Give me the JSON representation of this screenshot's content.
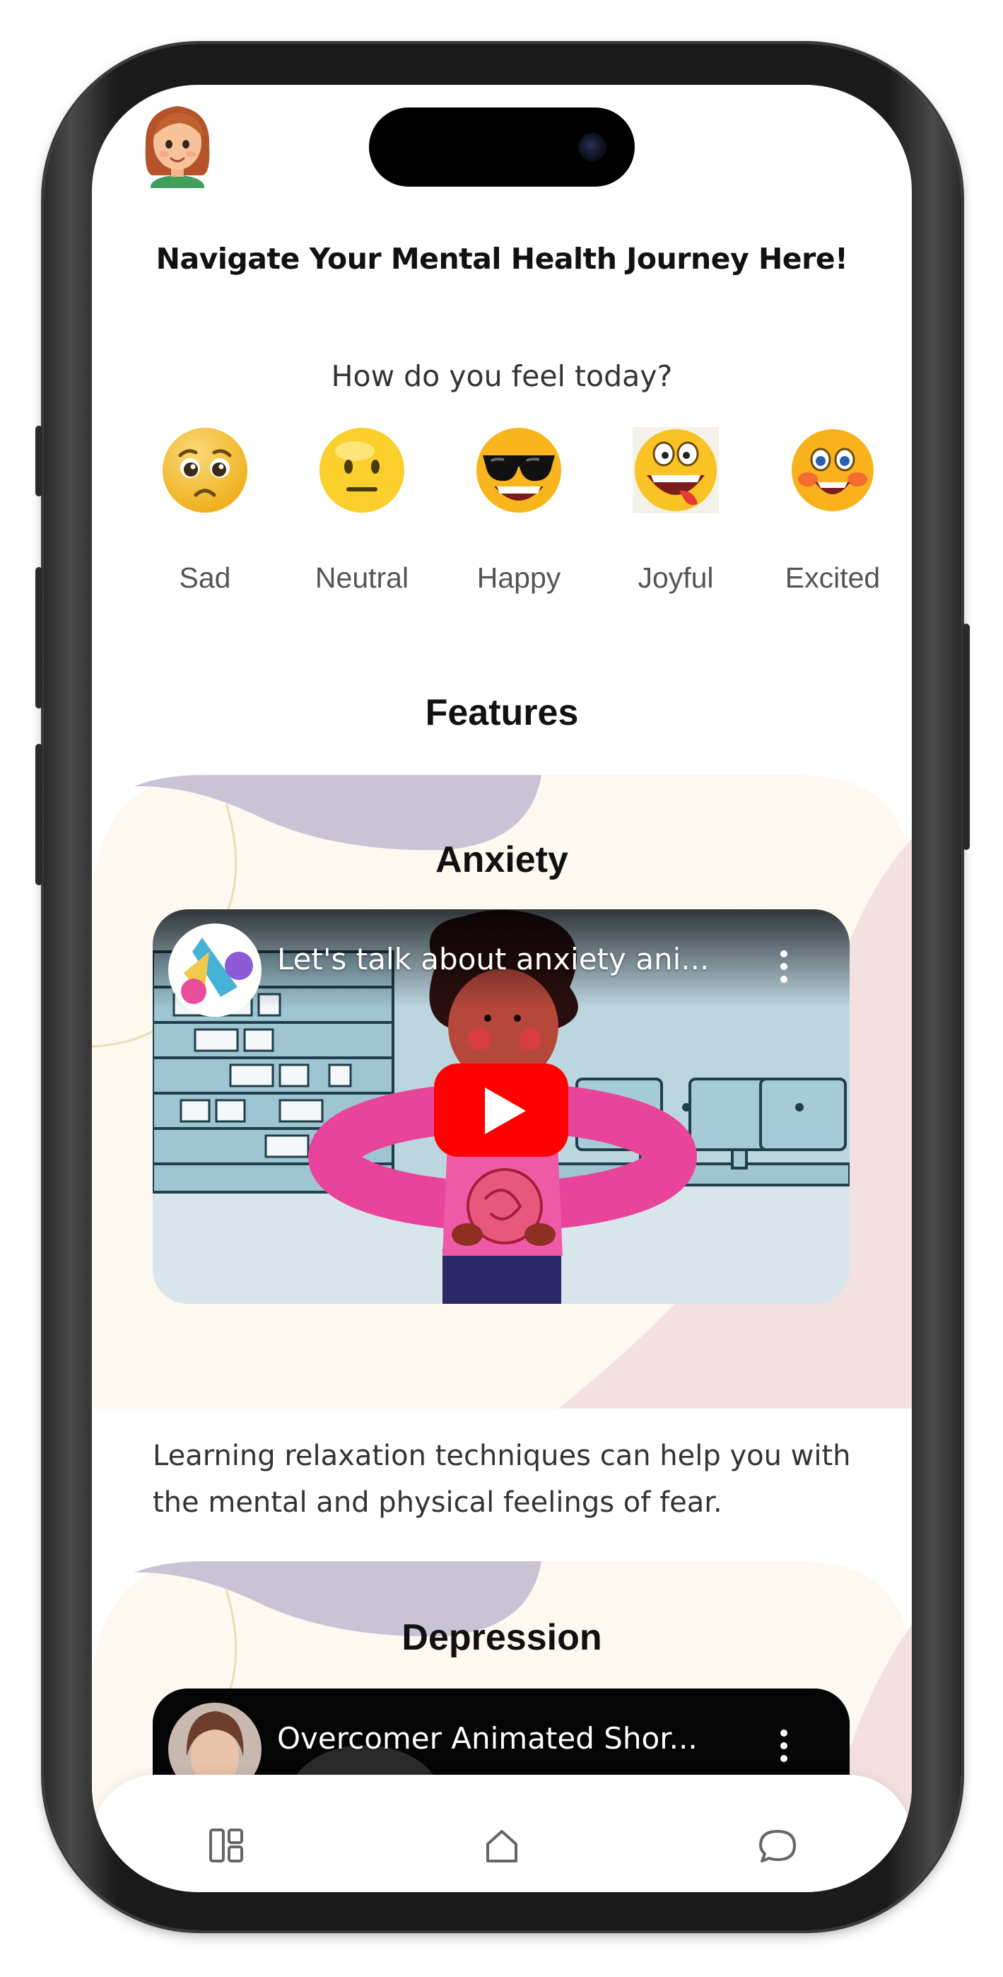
{
  "app": {
    "headline": "Navigate Your Mental Health Journey Here!",
    "mood_question": "How do you feel today?",
    "moods": [
      {
        "label": "Sad",
        "icon": "sad-emoji-icon"
      },
      {
        "label": "Neutral",
        "icon": "neutral-emoji-icon"
      },
      {
        "label": "Happy",
        "icon": "sunglasses-emoji-icon"
      },
      {
        "label": "Joyful",
        "icon": "joyful-emoji-icon"
      },
      {
        "label": "Excited",
        "icon": "excited-emoji-icon"
      }
    ],
    "features_title": "Features",
    "features": [
      {
        "title": "Anxiety",
        "video_title": "Let's talk about anxiety ani...",
        "description": "Learning relaxation techniques can help you with the mental and physical feelings of fear."
      },
      {
        "title": "Depression",
        "video_title": "Overcomer Animated Shor..."
      }
    ],
    "bottom_nav": [
      {
        "icon": "dashboard-icon"
      },
      {
        "icon": "home-icon"
      },
      {
        "icon": "chat-icon"
      }
    ],
    "colors": {
      "card_cream": "#fdf8f0",
      "card_lavender": "#c9c3d6",
      "card_pink": "#f4e0e0",
      "youtube_red": "#ff0000"
    }
  }
}
